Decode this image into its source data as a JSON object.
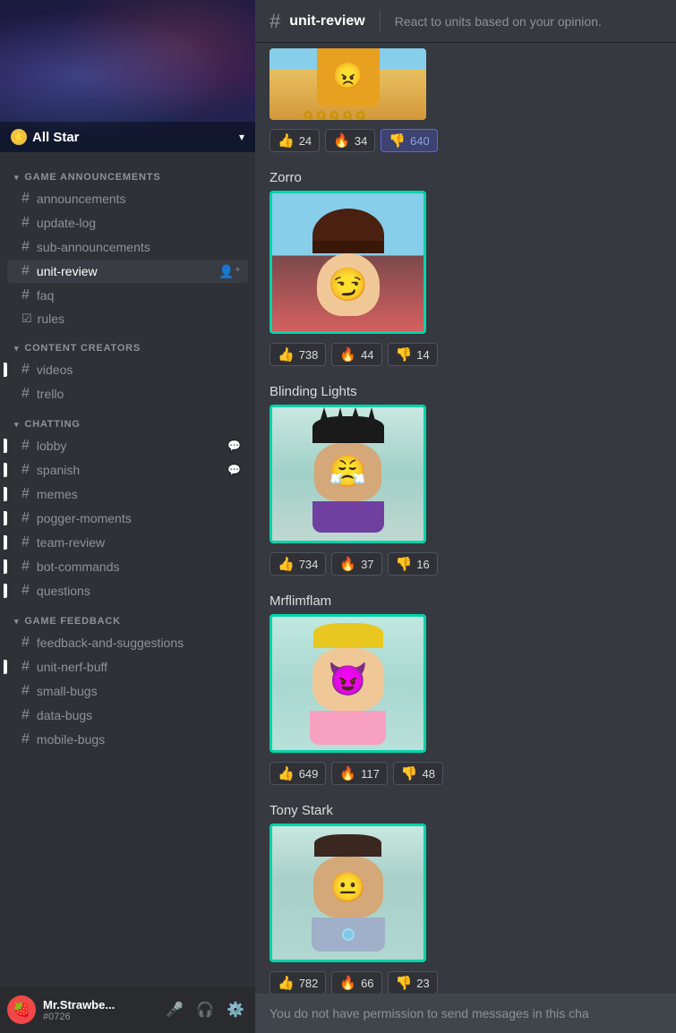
{
  "server": {
    "name": "All Star",
    "chevron": "▾",
    "banner_emoji": "⭐"
  },
  "sidebar": {
    "categories": [
      {
        "name": "GAME ANNOUNCEMENTS",
        "channels": [
          {
            "id": "announcements",
            "name": "announcements",
            "type": "hash",
            "active": false,
            "notification": false
          },
          {
            "id": "update-log",
            "name": "update-log",
            "type": "hash",
            "active": false,
            "notification": false
          },
          {
            "id": "sub-announcements",
            "name": "sub-announcements",
            "type": "hash",
            "active": false,
            "notification": false
          },
          {
            "id": "unit-review",
            "name": "unit-review",
            "type": "hash",
            "active": true,
            "notification": false,
            "add_icon": true
          },
          {
            "id": "faq",
            "name": "faq",
            "type": "hash",
            "active": false,
            "notification": false
          },
          {
            "id": "rules",
            "name": "rules",
            "type": "check",
            "active": false,
            "notification": false
          }
        ]
      },
      {
        "name": "CONTENT CREATORS",
        "channels": [
          {
            "id": "videos",
            "name": "videos",
            "type": "hash",
            "active": false,
            "notification": true
          },
          {
            "id": "trello",
            "name": "trello",
            "type": "hash",
            "active": false,
            "notification": false
          }
        ]
      },
      {
        "name": "CHATTING",
        "channels": [
          {
            "id": "lobby",
            "name": "lobby",
            "type": "hash",
            "active": false,
            "notification": true,
            "bubble": "💬"
          },
          {
            "id": "spanish",
            "name": "spanish",
            "type": "hash",
            "active": false,
            "notification": true,
            "bubble": "💬"
          },
          {
            "id": "memes",
            "name": "memes",
            "type": "hash",
            "active": false,
            "notification": true
          },
          {
            "id": "pogger-moments",
            "name": "pogger-moments",
            "type": "hash",
            "active": false,
            "notification": true
          },
          {
            "id": "team-review",
            "name": "team-review",
            "type": "hash",
            "active": false,
            "notification": true
          },
          {
            "id": "bot-commands",
            "name": "bot-commands",
            "type": "hash",
            "active": false,
            "notification": true
          },
          {
            "id": "questions",
            "name": "questions",
            "type": "hash",
            "active": false,
            "notification": true
          }
        ]
      },
      {
        "name": "GAME FEEDBACK",
        "channels": [
          {
            "id": "feedback-and-suggestions",
            "name": "feedback-and-suggestions",
            "type": "hash",
            "active": false,
            "notification": false
          },
          {
            "id": "unit-nerf-buff",
            "name": "unit-nerf-buff",
            "type": "hash",
            "active": false,
            "notification": true
          },
          {
            "id": "small-bugs",
            "name": "small-bugs",
            "type": "hash",
            "active": false,
            "notification": false
          },
          {
            "id": "data-bugs",
            "name": "data-bugs",
            "type": "hash",
            "active": false,
            "notification": false
          },
          {
            "id": "mobile-bugs",
            "name": "mobile-bugs",
            "type": "hash",
            "active": false,
            "notification": false
          }
        ]
      }
    ]
  },
  "header": {
    "channel": "unit-review",
    "description": "React to units based on your opinion."
  },
  "units": [
    {
      "id": "unit-top",
      "name": "",
      "bg": "orange",
      "partial": true,
      "reactions": [
        {
          "emoji": "👍",
          "count": "24",
          "highlighted": false
        },
        {
          "emoji": "🔥",
          "count": "34",
          "highlighted": false
        },
        {
          "emoji": "👎",
          "count": "640",
          "highlighted": true
        }
      ]
    },
    {
      "id": "zorro",
      "name": "Zorro",
      "bg": "teal",
      "reactions": [
        {
          "emoji": "👍",
          "count": "738",
          "highlighted": false
        },
        {
          "emoji": "🔥",
          "count": "44",
          "highlighted": false
        },
        {
          "emoji": "👎",
          "count": "14",
          "highlighted": false
        }
      ]
    },
    {
      "id": "blinding-lights",
      "name": "Blinding Lights",
      "bg": "teal",
      "reactions": [
        {
          "emoji": "👍",
          "count": "734",
          "highlighted": false
        },
        {
          "emoji": "🔥",
          "count": "37",
          "highlighted": false
        },
        {
          "emoji": "👎",
          "count": "16",
          "highlighted": false
        }
      ]
    },
    {
      "id": "mrflimflam",
      "name": "Mrflimflam",
      "bg": "teal",
      "reactions": [
        {
          "emoji": "👍",
          "count": "649",
          "highlighted": false
        },
        {
          "emoji": "🔥",
          "count": "117",
          "highlighted": false
        },
        {
          "emoji": "👎",
          "count": "48",
          "highlighted": false
        }
      ]
    },
    {
      "id": "tony-stark",
      "name": "Tony Stark",
      "bg": "teal",
      "reactions": [
        {
          "emoji": "👍",
          "count": "782",
          "highlighted": false
        },
        {
          "emoji": "🔥",
          "count": "66",
          "highlighted": false
        },
        {
          "emoji": "👎",
          "count": "23",
          "highlighted": false
        }
      ]
    }
  ],
  "no_permission_text": "You do not have permission to send messages in this cha",
  "user": {
    "name": "Mr.Strawbe...",
    "tag": "#0726",
    "avatar_emoji": "🍓"
  }
}
